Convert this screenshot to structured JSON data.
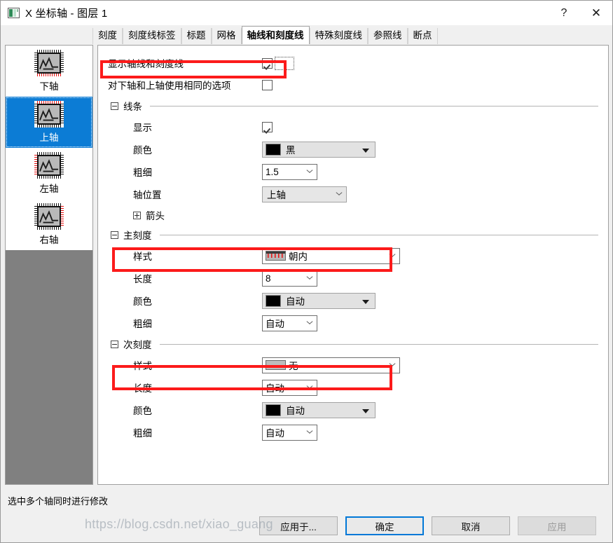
{
  "window": {
    "title": "X 坐标轴 - 图层 1",
    "icon": "layer-axis-icon",
    "help_label": "?",
    "close_label": "✕"
  },
  "tabs": [
    {
      "label": "刻度",
      "active": false
    },
    {
      "label": "刻度线标签",
      "active": false
    },
    {
      "label": "标题",
      "active": false
    },
    {
      "label": "网格",
      "active": false
    },
    {
      "label": "轴线和刻度线",
      "active": true
    },
    {
      "label": "特殊刻度线",
      "active": false
    },
    {
      "label": "参照线",
      "active": false
    },
    {
      "label": "断点",
      "active": false
    }
  ],
  "sidebar": {
    "items": [
      {
        "label": "下轴",
        "icon": "axis-bottom-icon",
        "selected": false,
        "side": "bottom"
      },
      {
        "label": "上轴",
        "icon": "axis-top-icon",
        "selected": true,
        "side": "top"
      },
      {
        "label": "左轴",
        "icon": "axis-left-icon",
        "selected": false,
        "side": "left"
      },
      {
        "label": "右轴",
        "icon": "axis-right-icon",
        "selected": false,
        "side": "right"
      }
    ]
  },
  "panel": {
    "show_axis_and_ticks": {
      "label": "显示轴线和刻度线",
      "checked": true
    },
    "same_options_for_both": {
      "label": "对下轴和上轴使用相同的选项",
      "checked": false
    },
    "groups": {
      "line": {
        "title": "线条",
        "expanded": true,
        "show": {
          "label": "显示",
          "checked": true
        },
        "color": {
          "label": "颜色",
          "value": "黑",
          "swatch": "#000000"
        },
        "thickness": {
          "label": "粗细",
          "value": "1.5"
        },
        "axis_position": {
          "label": "轴位置",
          "value": "上轴"
        },
        "arrow": {
          "label": "箭头",
          "expanded": false
        }
      },
      "major_ticks": {
        "title": "主刻度",
        "expanded": true,
        "style": {
          "label": "样式",
          "value": "朝内",
          "preview": "ticks-inward-icon"
        },
        "length": {
          "label": "长度",
          "value": "8"
        },
        "color": {
          "label": "颜色",
          "value": "自动",
          "swatch": "#000000"
        },
        "thickness": {
          "label": "粗细",
          "value": "自动"
        }
      },
      "minor_ticks": {
        "title": "次刻度",
        "expanded": true,
        "style": {
          "label": "样式",
          "value": "无",
          "preview": "ticks-none-icon"
        },
        "length": {
          "label": "长度",
          "value": "自动"
        },
        "color": {
          "label": "颜色",
          "value": "自动",
          "swatch": "#000000"
        },
        "thickness": {
          "label": "粗细",
          "value": "自动"
        }
      }
    }
  },
  "footer": {
    "status": "选中多个轴同时进行修改",
    "buttons": [
      {
        "label": "应用于...",
        "state": "normal"
      },
      {
        "label": "确定",
        "state": "default"
      },
      {
        "label": "取消",
        "state": "normal"
      },
      {
        "label": "应用",
        "state": "disabled"
      }
    ],
    "watermark": "https://blog.csdn.net/xiao_guang"
  },
  "highlight_color": "#fc1b1b"
}
